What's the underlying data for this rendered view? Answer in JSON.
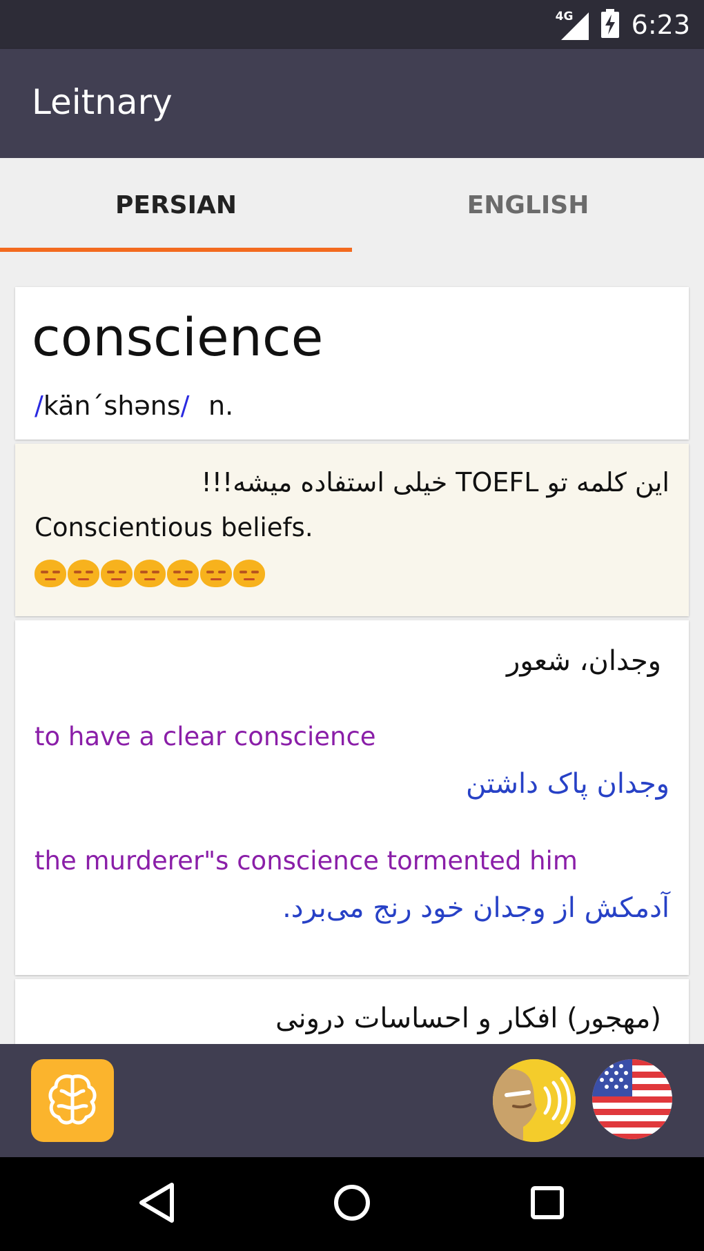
{
  "status_bar": {
    "network": "4G",
    "time": "6:23"
  },
  "app_bar": {
    "title": "Leitnary"
  },
  "tabs": [
    {
      "label": "PERSIAN",
      "selected": true
    },
    {
      "label": "ENGLISH",
      "selected": false
    }
  ],
  "colors": {
    "app_bar": "#413f52",
    "status_bar": "#2d2c37",
    "tab_indicator": "#f36a1f",
    "note_bg": "#f9f6ec",
    "example_en": "#8a1ea8",
    "example_fa": "#2741c6",
    "brain_button": "#fbb42d"
  },
  "word_card": {
    "word": "conscience",
    "slash_open": "/",
    "pronunciation": "kän´shəns",
    "slash_close": "/",
    "part_of_speech": "n."
  },
  "note_card": {
    "persian_note": "این کلمه تو TOEFL خیلی استفاده میشه!!!",
    "english_note": "Conscientious beliefs.",
    "emoji_count": 7
  },
  "definition_card": {
    "meaning": "وجدان، شعور",
    "examples": [
      {
        "en": "to have a clear conscience",
        "fa": "وجدان پاک داشتن"
      },
      {
        "en": "the murderer\"s conscience tormented him",
        "fa": "آدمکش از وجدان خود رنج می‌برد."
      }
    ]
  },
  "definition_card_2": {
    "meaning": "(مهجور) افکار و احساسات درونی"
  },
  "action_bar": {
    "icons": [
      "brain-icon",
      "speaker-pronounce-icon",
      "us-flag-icon"
    ]
  },
  "nav_bar": {
    "icons": [
      "back-icon",
      "home-icon",
      "recents-icon"
    ]
  }
}
